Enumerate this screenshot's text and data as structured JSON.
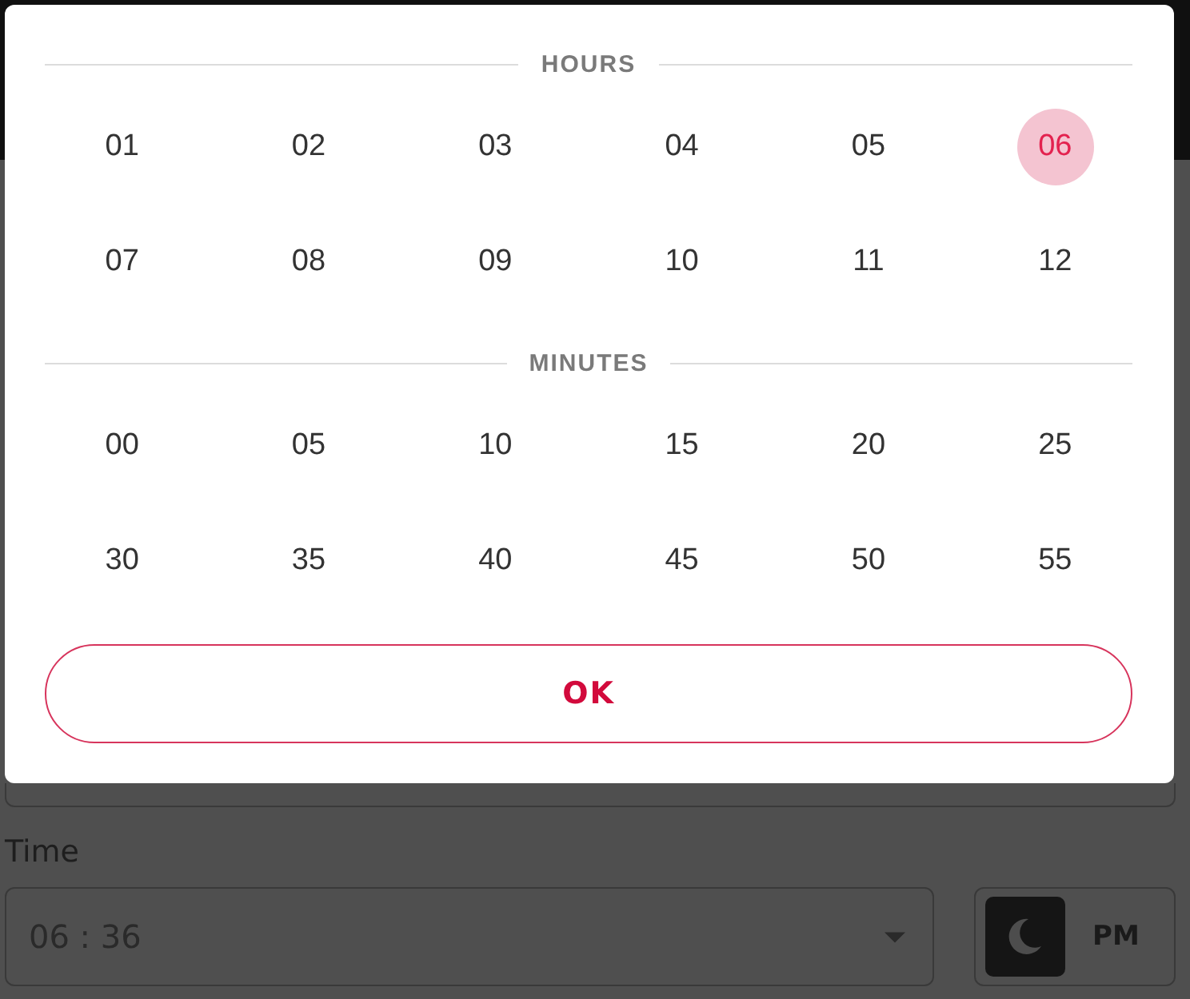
{
  "dialog": {
    "hours": {
      "heading": "HOURS",
      "options": [
        {
          "label": "01",
          "selected": false
        },
        {
          "label": "02",
          "selected": false
        },
        {
          "label": "03",
          "selected": false
        },
        {
          "label": "04",
          "selected": false
        },
        {
          "label": "05",
          "selected": false
        },
        {
          "label": "06",
          "selected": true
        },
        {
          "label": "07",
          "selected": false
        },
        {
          "label": "08",
          "selected": false
        },
        {
          "label": "09",
          "selected": false
        },
        {
          "label": "10",
          "selected": false
        },
        {
          "label": "11",
          "selected": false
        },
        {
          "label": "12",
          "selected": false
        }
      ]
    },
    "minutes": {
      "heading": "MINUTES",
      "options": [
        {
          "label": "00",
          "selected": false
        },
        {
          "label": "05",
          "selected": false
        },
        {
          "label": "10",
          "selected": false
        },
        {
          "label": "15",
          "selected": false
        },
        {
          "label": "20",
          "selected": false
        },
        {
          "label": "25",
          "selected": false
        },
        {
          "label": "30",
          "selected": false
        },
        {
          "label": "35",
          "selected": false
        },
        {
          "label": "40",
          "selected": false
        },
        {
          "label": "45",
          "selected": false
        },
        {
          "label": "50",
          "selected": false
        },
        {
          "label": "55",
          "selected": false
        }
      ]
    },
    "ok_button": "OK"
  },
  "form": {
    "time": {
      "label": "Time",
      "value": "06 : 36"
    },
    "period": {
      "label": "PM"
    }
  }
}
